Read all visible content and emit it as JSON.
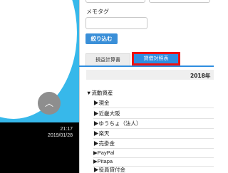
{
  "taskbar": {
    "time": "21:17",
    "date": "2019/01/28"
  },
  "scroll_top_icon": "chevron-up-icon",
  "form": {
    "memo_tag_label": "メモタグ",
    "memo_tag_value": "",
    "filter_button": "絞り込む"
  },
  "tabs": [
    {
      "label": "損益計算書",
      "active": false
    },
    {
      "label": "貸借対照表",
      "active": true
    }
  ],
  "table": {
    "year_header": "2018年",
    "section": "▼流動資産",
    "rows": [
      "▶現金",
      "▶近畿大阪",
      "▶ゆうちょ（法人）",
      "▶楽天",
      "▶売掛金",
      "▶PayPal",
      "▶Pitapa",
      "▶役員貸付金"
    ]
  },
  "colors": {
    "accent": "#2f8ee0",
    "highlight_border": "#ee1111",
    "wallpaper": "#37b8ea"
  }
}
